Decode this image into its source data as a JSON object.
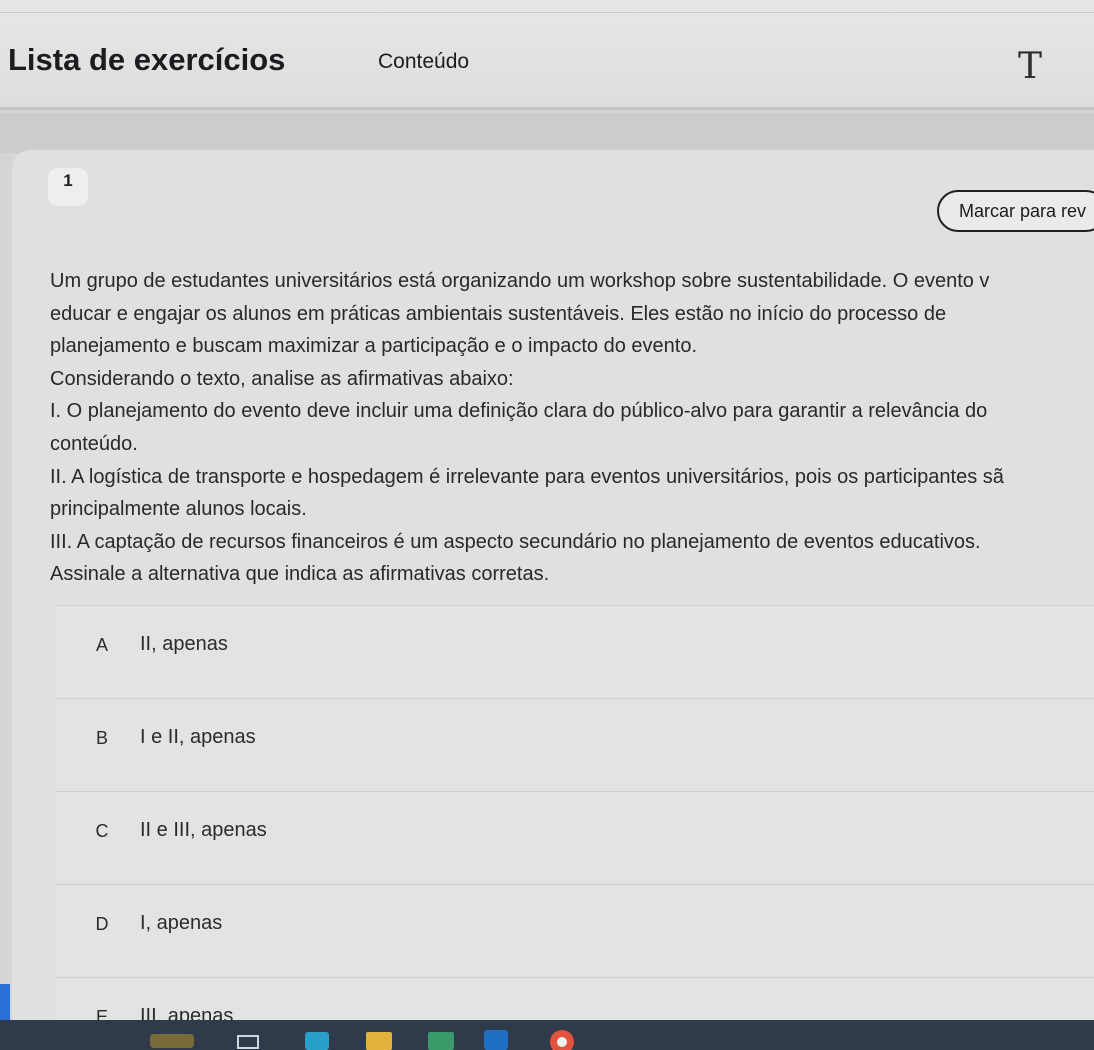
{
  "header": {
    "title": "Lista de exercícios",
    "tab": "Conteúdo",
    "text_tool_icon": "T"
  },
  "question": {
    "number": "1",
    "review_button": "Marcar para rev",
    "stem": [
      "Um grupo de estudantes universitários está organizando um workshop sobre sustentabilidade. O evento v",
      "educar e engajar os alunos em práticas ambientais sustentáveis. Eles estão no início do processo de",
      "planejamento e buscam maximizar a participação e o impacto do evento.",
      "Considerando o texto, analise as afirmativas abaixo:",
      "I. O planejamento do evento deve incluir uma definição clara do público-alvo para garantir a relevância do",
      "conteúdo.",
      "II. A logística de transporte e hospedagem é irrelevante para eventos universitários, pois os participantes sã",
      "principalmente alunos locais.",
      "III. A captação de recursos financeiros é um aspecto secundário no planejamento de eventos educativos.",
      "Assinale a alternativa que indica as afirmativas corretas."
    ],
    "options": [
      {
        "letter": "A",
        "text": "II, apenas"
      },
      {
        "letter": "B",
        "text": "I e II, apenas"
      },
      {
        "letter": "C",
        "text": "II e III, apenas"
      },
      {
        "letter": "D",
        "text": "I, apenas"
      },
      {
        "letter": "E",
        "text": "III, apenas"
      }
    ]
  },
  "colors": {
    "accent": "#2b6fd6",
    "taskbar": "#2f3b4a"
  }
}
